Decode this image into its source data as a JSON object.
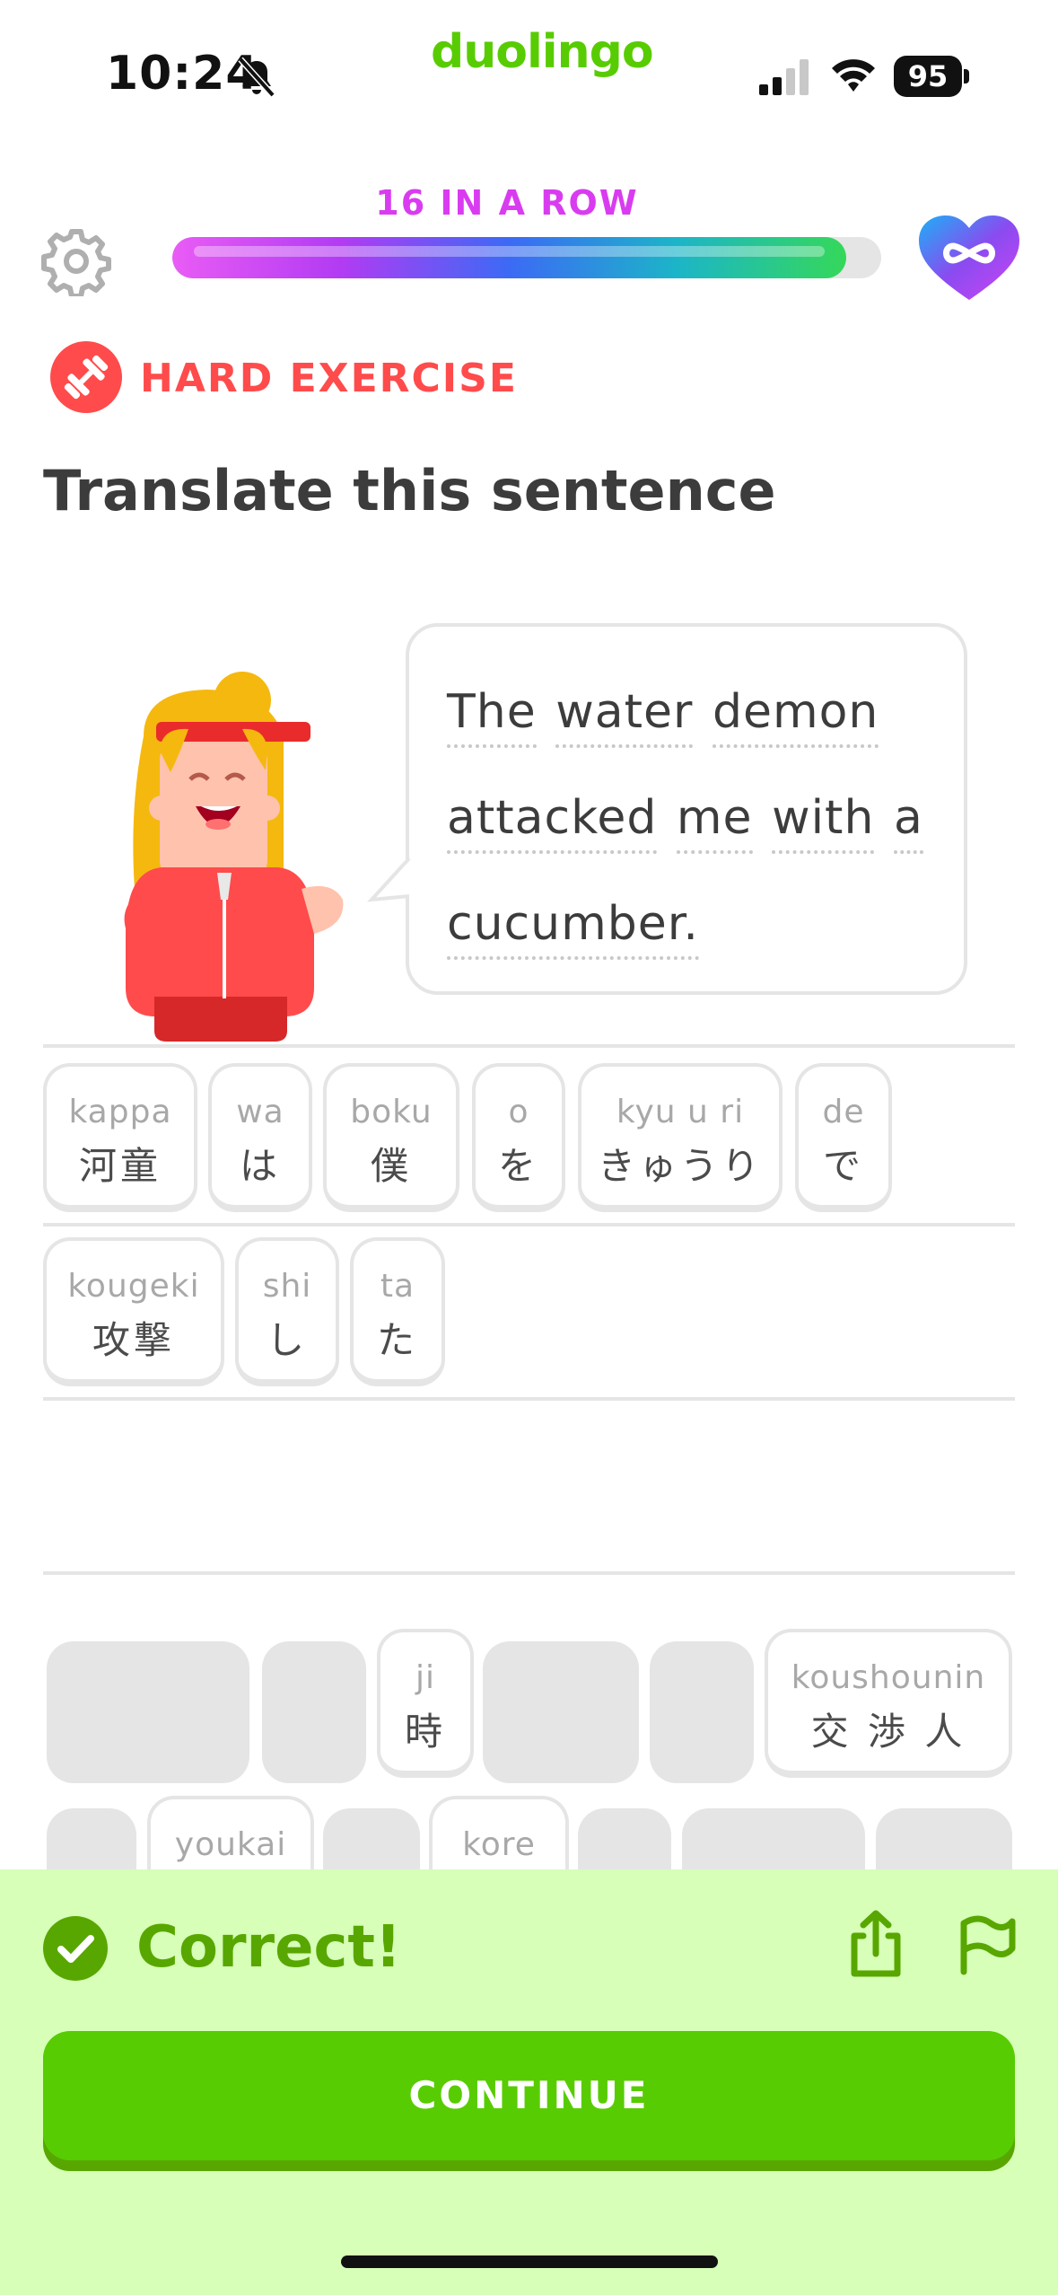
{
  "status_bar": {
    "time": "10:24",
    "battery": "95"
  },
  "app": {
    "brand": "duolingo"
  },
  "header": {
    "streak_text": "16 IN A ROW",
    "progress": 0.95,
    "hearts": "∞",
    "icons": {
      "settings": "gear-icon",
      "hearts": "infinity-heart-icon"
    }
  },
  "exercise": {
    "difficulty": "HARD EXERCISE",
    "instruction": "Translate this sentence",
    "sentence_words": [
      "The",
      "water",
      "demon",
      "attacked",
      "me",
      "with",
      "a",
      "cucumber."
    ]
  },
  "answer": {
    "tiles": [
      {
        "romaji": "kappa",
        "text": "河童"
      },
      {
        "romaji": "wa",
        "text": "は"
      },
      {
        "romaji": "boku",
        "text": "僕"
      },
      {
        "romaji": "o",
        "text": "を"
      },
      {
        "romaji": "kyu u ri",
        "text": "きゅうり"
      },
      {
        "romaji": "de",
        "text": "で"
      },
      {
        "romaji": "kougeki",
        "text": "攻撃"
      },
      {
        "romaji": "shi",
        "text": "し"
      },
      {
        "romaji": "ta",
        "text": "た"
      }
    ]
  },
  "word_bank": {
    "remaining": [
      {
        "romaji": "ji",
        "text": "時"
      },
      {
        "romaji": "koushounin",
        "text": "交 渉 人"
      },
      {
        "romaji": "youkai",
        "text": ""
      },
      {
        "romaji": "kore",
        "text": ""
      }
    ]
  },
  "feedback": {
    "result": "Correct!",
    "continue_label": "CONTINUE",
    "colors": {
      "success": "#58a700",
      "panel": "#d7ffb8",
      "button": "#58cc02"
    }
  }
}
